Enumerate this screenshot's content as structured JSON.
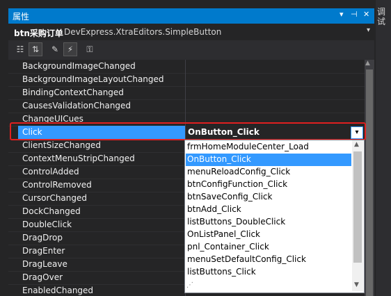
{
  "panel": {
    "title": "属性",
    "pin_icon": "pin-icon",
    "close_icon": "close-icon",
    "side_tab": "调试"
  },
  "object": {
    "name": "btn采购订单",
    "type": "DevExpress.XtraEditors.SimpleButton"
  },
  "toolbar": {
    "icons": [
      "categorized-icon",
      "alphabetical-icon",
      "properties-icon",
      "events-icon",
      "property-pages-icon"
    ]
  },
  "events": [
    "BackgroundImageChanged",
    "BackgroundImageLayoutChanged",
    "BindingContextChanged",
    "CausesValidationChanged",
    "ChangeUICues",
    "Click",
    "ClientSizeChanged",
    "ContextMenuStripChanged",
    "ControlAdded",
    "ControlRemoved",
    "CursorChanged",
    "DockChanged",
    "DoubleClick",
    "DragDrop",
    "DragEnter",
    "DragLeave",
    "DragOver",
    "EnabledChanged"
  ],
  "selected_event": {
    "name": "Click",
    "value": "OnButton_Click"
  },
  "dropdown": {
    "options": [
      "frmHomeModuleCenter_Load",
      "OnButton_Click",
      "menuReloadConfig_Click",
      "btnConfigFunction_Click",
      "btnSaveConfig_Click",
      "btnAdd_Click",
      "listButtons_DoubleClick",
      "OnListPanel_Click",
      "pnl_Container_Click",
      "menuSetDefaultConfig_Click",
      "listButtons_Click"
    ],
    "highlighted_index": 1
  },
  "colors": {
    "accent": "#007acc",
    "selection": "#3399ff",
    "highlight_box": "#e02020"
  }
}
